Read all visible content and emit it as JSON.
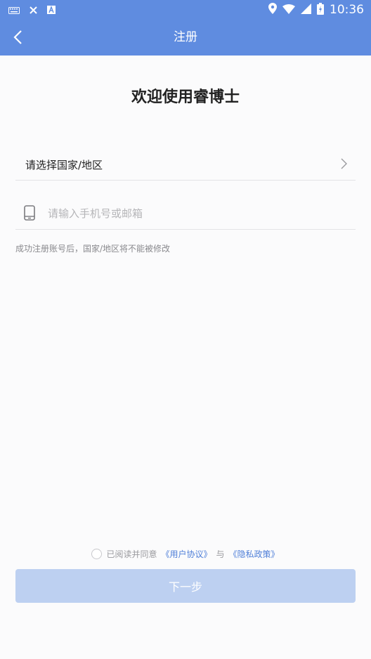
{
  "status_bar": {
    "time": "10:36",
    "icons": [
      "keyboard-icon",
      "close-icon",
      "a-icon",
      "location-icon",
      "wifi-icon",
      "signal-icon",
      "battery-icon"
    ]
  },
  "app_bar": {
    "title": "注册",
    "bg_color": "#5f8ce0"
  },
  "main": {
    "welcome": "欢迎使用睿博士",
    "country_label": "请选择国家/地区",
    "phone_placeholder": "请输入手机号或邮箱",
    "hint": "成功注册账号后，国家/地区将不能被修改"
  },
  "agreement": {
    "prefix": "已阅读并同意",
    "user_agreement": "《用户协议》",
    "joiner": "与",
    "privacy_policy": "《隐私政策》",
    "link_color": "#4f7fd8"
  },
  "next_button": {
    "label": "下一步",
    "bg_color": "#bdd0f1"
  }
}
